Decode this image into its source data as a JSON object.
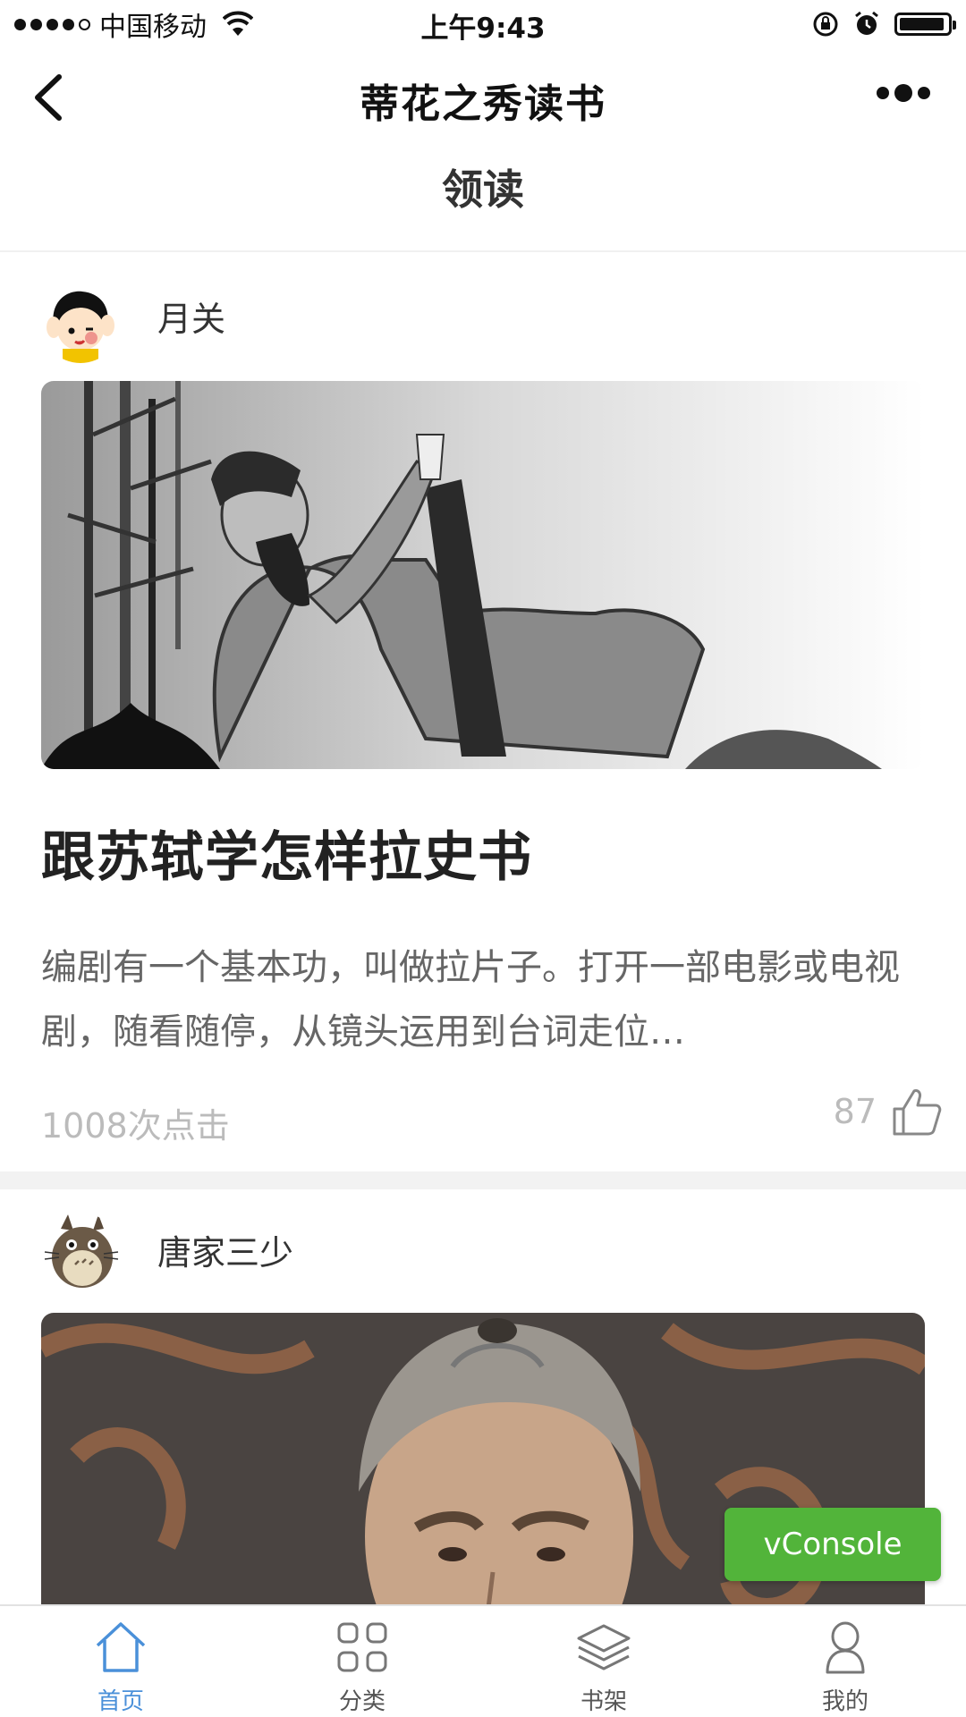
{
  "status_bar": {
    "carrier": "中国移动",
    "time": "上午9:43",
    "battery_level": 0.95
  },
  "nav": {
    "title": "蒂花之秀读书"
  },
  "section": {
    "title": "领读"
  },
  "articles": [
    {
      "author": "月关",
      "title": "跟苏轼学怎样拉史书",
      "description": "编剧有一个基本功，叫做拉片子。打开一部电影或电视剧，随看随停，从镜头运用到台词走位…",
      "clicks": "1008次点击",
      "likes": "87"
    },
    {
      "author": "唐家三少"
    }
  ],
  "vconsole": {
    "label": "vConsole"
  },
  "tabs": [
    {
      "label": "首页",
      "icon": "home-icon",
      "active": true
    },
    {
      "label": "分类",
      "icon": "grid-icon",
      "active": false
    },
    {
      "label": "书架",
      "icon": "layers-icon",
      "active": false
    },
    {
      "label": "我的",
      "icon": "person-icon",
      "active": false
    }
  ],
  "colors": {
    "accent": "#4a90d9",
    "vconsole": "#52b43a",
    "muted": "#bbbbbb"
  }
}
